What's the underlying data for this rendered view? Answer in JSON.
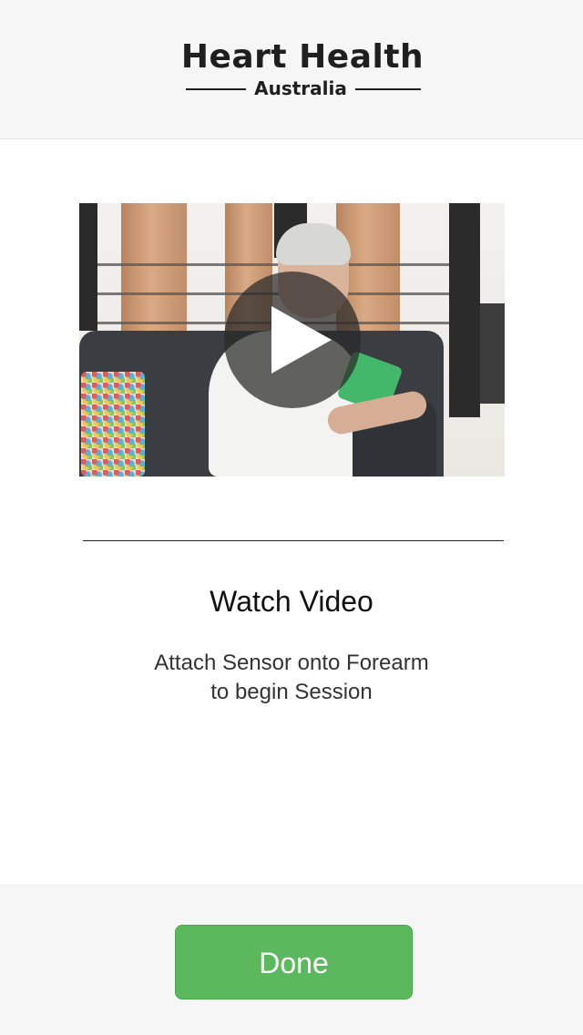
{
  "header": {
    "logo": {
      "title": "Heart Health",
      "subtitle": "Australia"
    }
  },
  "video": {
    "play_icon": "play-icon"
  },
  "main": {
    "title": "Watch Video",
    "instruction_line1": "Attach Sensor onto Forearm",
    "instruction_line2": "to begin Session"
  },
  "footer": {
    "done_label": "Done"
  },
  "colors": {
    "accent_green": "#5cb85c",
    "header_bg": "#f6f6f6",
    "text_dark": "#111111"
  }
}
